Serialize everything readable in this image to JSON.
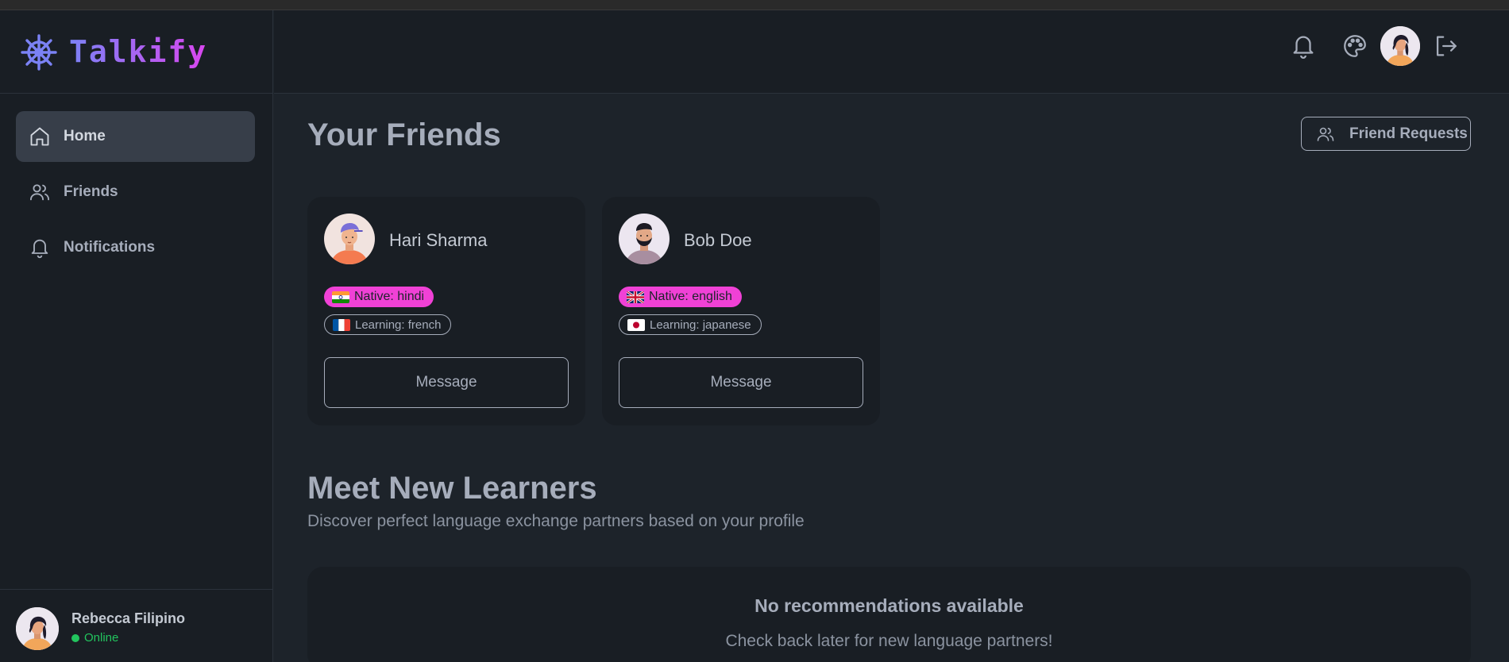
{
  "app": {
    "brand_name": "Talkify",
    "accent_gradient": [
      "#7b82f5",
      "#d946ef"
    ]
  },
  "sidebar": {
    "items": [
      {
        "label": "Home",
        "icon": "home-icon",
        "active": true
      },
      {
        "label": "Friends",
        "icon": "users-icon",
        "active": false
      },
      {
        "label": "Notifications",
        "icon": "bell-icon",
        "active": false
      }
    ],
    "user": {
      "name": "Rebecca Filipino",
      "status": "Online"
    }
  },
  "header": {
    "icons": [
      "bell-icon",
      "palette-icon",
      "user-avatar",
      "logout-icon"
    ]
  },
  "main": {
    "friends_title": "Your Friends",
    "friend_requests_label": "Friend Requests",
    "friends": [
      {
        "name": "Hari Sharma",
        "native": "Native: hindi",
        "native_flag": "india-flag",
        "learning": "Learning: french",
        "learning_flag": "france-flag",
        "action": "Message"
      },
      {
        "name": "Bob Doe",
        "native": "Native: english",
        "native_flag": "uk-flag",
        "learning": "Learning: japanese",
        "learning_flag": "japan-flag",
        "action": "Message"
      }
    ],
    "learners_title": "Meet New Learners",
    "learners_subtitle": "Discover perfect language exchange partners based on your profile",
    "empty_title": "No recommendations available",
    "empty_subtitle": "Check back later for new language partners!"
  },
  "colors": {
    "background": "#1d232a",
    "surface": "#191e24",
    "native_badge": "#f041d6",
    "online": "#22c55e"
  }
}
